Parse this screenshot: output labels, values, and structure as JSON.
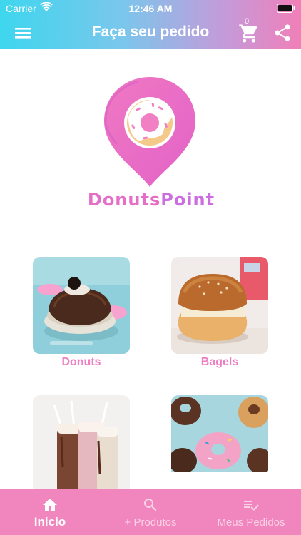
{
  "status_bar": {
    "carrier": "Carrier",
    "time": "12:46 AM"
  },
  "header": {
    "title": "Faça seu pedido",
    "cart_count": "0"
  },
  "logo": {
    "word_part1": "Donuts",
    "word_part2": "Point"
  },
  "categories": [
    {
      "label": "Donuts"
    },
    {
      "label": "Bagels"
    },
    {
      "label": ""
    },
    {
      "label": ""
    }
  ],
  "tabs": [
    {
      "label": "Inicio",
      "icon": "home-icon",
      "active": true
    },
    {
      "label": "+ Produtos",
      "icon": "search-icon",
      "active": false
    },
    {
      "label": "Meus Pedidos",
      "icon": "checklist-icon",
      "active": false
    }
  ],
  "colors": {
    "accent_pink": "#f185bd",
    "label_pink": "#ee7fc2",
    "header_cyan": "#3ed6ee"
  }
}
